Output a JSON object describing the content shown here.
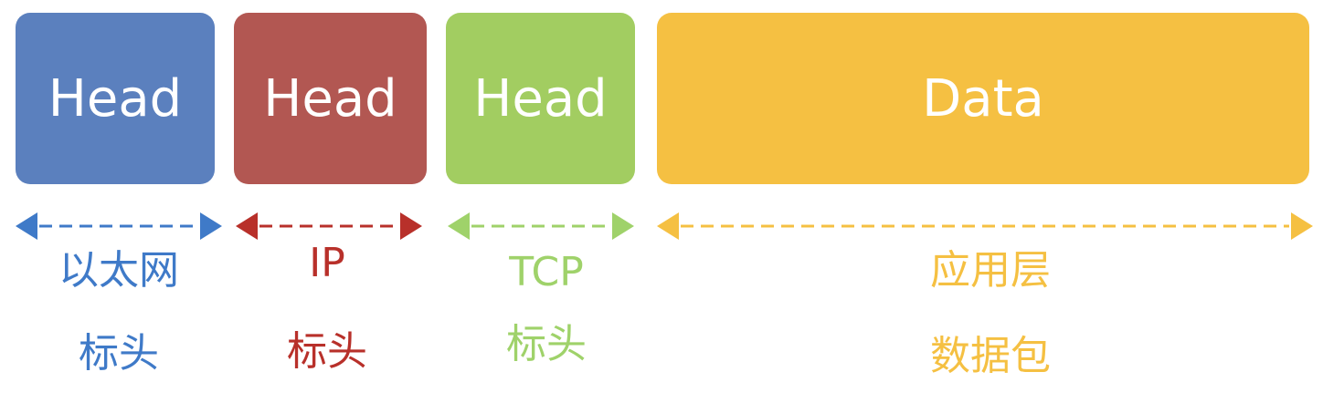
{
  "segments": [
    {
      "id": "ethernet",
      "block_text": "Head",
      "label_line1": "以太网",
      "label_line2": "标头",
      "color": "#5b80be",
      "label_color": "#3f7ac8"
    },
    {
      "id": "ip",
      "block_text": "Head",
      "label_line1": "IP",
      "label_line2": "标头",
      "color": "#b25752",
      "label_color": "#b8302a"
    },
    {
      "id": "tcp",
      "block_text": "Head",
      "label_line1": "TCP",
      "label_line2": "标头",
      "color": "#a2cd61",
      "label_color": "#9fd26a"
    },
    {
      "id": "application",
      "block_text": "Data",
      "label_line1": "应用层",
      "label_line2": "数据包",
      "color": "#f5c042",
      "label_color": "#f5c042"
    }
  ]
}
